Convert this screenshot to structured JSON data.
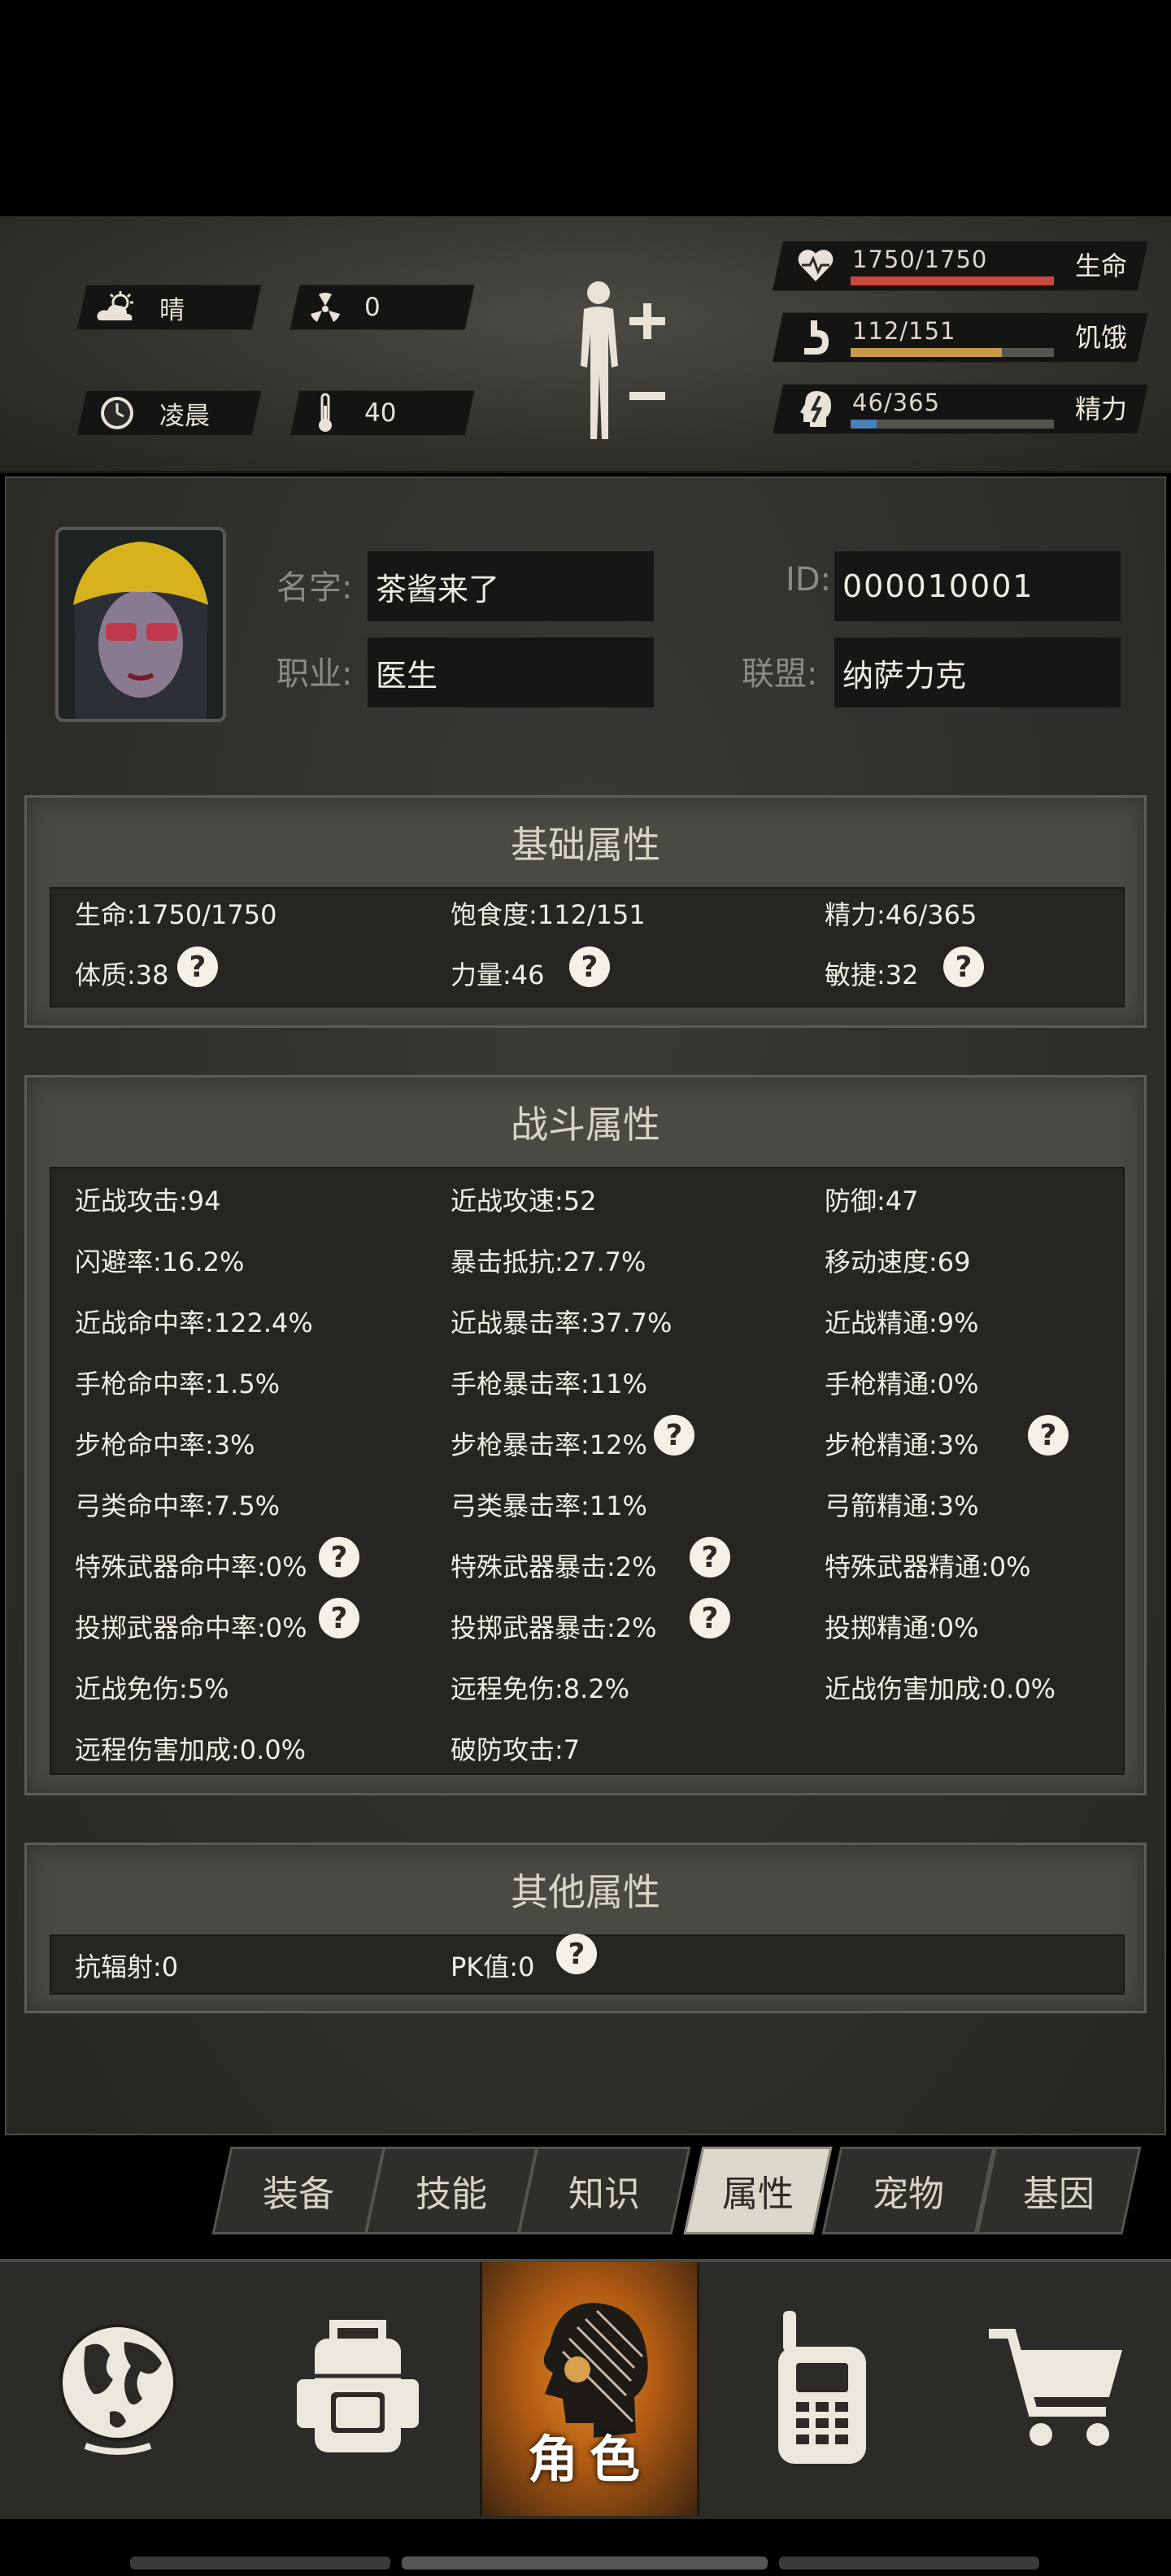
{
  "weather": {
    "label": "晴",
    "icon": "cloud-sun-icon"
  },
  "radiation": {
    "value": "0",
    "icon": "radiation-icon"
  },
  "time_of_day": {
    "label": "凌晨",
    "icon": "clock-icon"
  },
  "temperature": {
    "value": "40",
    "icon": "thermometer-icon"
  },
  "vitals": [
    {
      "name": "生命",
      "value": "1750/1750",
      "fill": 1.0,
      "color": "#c8493a",
      "icon": "heart-pulse-icon"
    },
    {
      "name": "饥饿",
      "value": "112/151",
      "fill": 0.742,
      "color": "#c89a45",
      "icon": "stomach-icon"
    },
    {
      "name": "精力",
      "value": "46/365",
      "fill": 0.126,
      "color": "#4a7fb8",
      "icon": "head-bolt-icon"
    }
  ],
  "profile": {
    "name_label": "名字:",
    "name": "茶酱来了",
    "id_label": "ID:",
    "id": "000010001",
    "job_label": "职业:",
    "job": "医生",
    "alliance_label": "联盟:",
    "alliance": "纳萨力克"
  },
  "basic": {
    "title": "基础属性",
    "stats": [
      "生命:1750/1750",
      "饱食度:112/151",
      "精力:46/365",
      "体质:38",
      "力量:46",
      "敏捷:32"
    ]
  },
  "combat": {
    "title": "战斗属性",
    "stats": [
      "近战攻击:94",
      "近战攻速:52",
      "防御:47",
      "闪避率:16.2%",
      "暴击抵抗:27.7%",
      "移动速度:69",
      "近战命中率:122.4%",
      "近战暴击率:37.7%",
      "近战精通:9%",
      "手枪命中率:1.5%",
      "手枪暴击率:11%",
      "手枪精通:0%",
      "步枪命中率:3%",
      "步枪暴击率:12%",
      "步枪精通:3%",
      "弓类命中率:7.5%",
      "弓类暴击率:11%",
      "弓箭精通:3%",
      "特殊武器命中率:0%",
      "特殊武器暴击:2%",
      "特殊武器精通:0%",
      "投掷武器命中率:0%",
      "投掷武器暴击:2%",
      "投掷精通:0%",
      "近战免伤:5%",
      "远程免伤:8.2%",
      "近战伤害加成:0.0%",
      "远程伤害加成:0.0%",
      "破防攻击:7"
    ]
  },
  "other": {
    "title": "其他属性",
    "stats": [
      "抗辐射:0",
      "PK值:0"
    ]
  },
  "help_glyph": "?",
  "tabs": [
    {
      "label": "装备",
      "active": false
    },
    {
      "label": "技能",
      "active": false
    },
    {
      "label": "知识",
      "active": false
    },
    {
      "label": "属性",
      "active": true
    },
    {
      "label": "宠物",
      "active": false
    },
    {
      "label": "基因",
      "active": false
    }
  ],
  "nav": [
    {
      "icon": "globe-icon"
    },
    {
      "icon": "backpack-icon"
    },
    {
      "icon": "character-head-icon",
      "label": "角色",
      "active": true
    },
    {
      "icon": "walkie-talkie-icon"
    },
    {
      "icon": "shopping-cart-icon"
    }
  ]
}
